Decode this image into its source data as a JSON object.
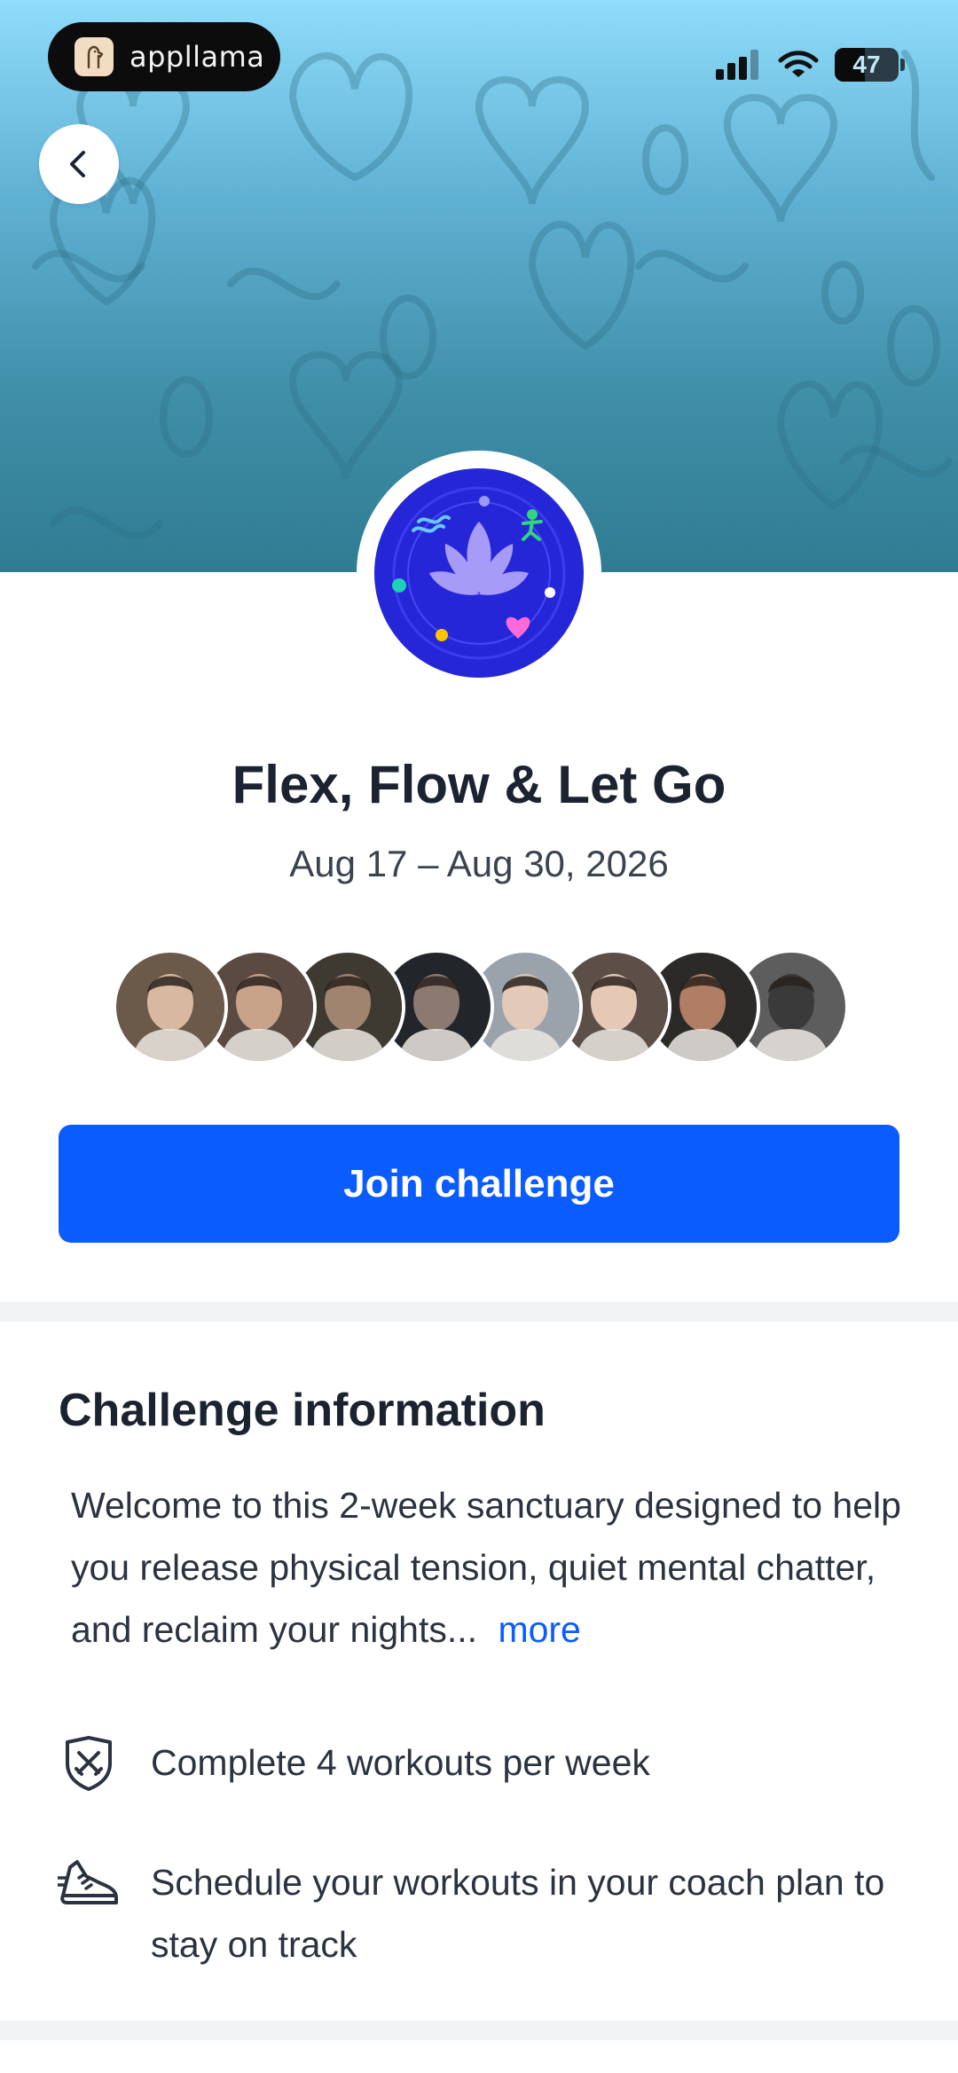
{
  "status_bar": {
    "app_name": "appllama",
    "battery": "47"
  },
  "header": {
    "back_icon": "chevron-left-icon",
    "badge_icon": "lotus-badge-icon"
  },
  "challenge": {
    "title": "Flex, Flow & Let Go",
    "dates": "Aug 17 – Aug 30, 2026",
    "participants": [
      {
        "colors": [
          "#6b5a4a",
          "#d8b8a0"
        ]
      },
      {
        "colors": [
          "#5a4a42",
          "#c9a28a"
        ]
      },
      {
        "colors": [
          "#3e3a32",
          "#a08470"
        ]
      },
      {
        "colors": [
          "#22252a",
          "#8c7a70"
        ]
      },
      {
        "colors": [
          "#9aa2ac",
          "#e2c9b8"
        ]
      },
      {
        "colors": [
          "#5b4f48",
          "#e6c8b6"
        ]
      },
      {
        "colors": [
          "#2b2a28",
          "#b07e64"
        ]
      },
      {
        "colors": [
          "#5d5d5d",
          "#3a3a3a"
        ]
      }
    ],
    "join_label": "Join challenge"
  },
  "info": {
    "heading": "Challenge information",
    "description": "Welcome to this 2-week sanctuary designed to help you release physical tension, quiet mental chatter, and reclaim your nights...",
    "more_label": "more",
    "rules": [
      {
        "icon": "shield-swords-icon",
        "text": "Complete 4 workouts per week"
      },
      {
        "icon": "running-shoe-icon",
        "text": "Schedule your workouts in your coach plan to stay on track"
      }
    ]
  },
  "colors": {
    "accent": "#0a5cff",
    "text": "#1c2330",
    "badge": "#2626d9"
  }
}
